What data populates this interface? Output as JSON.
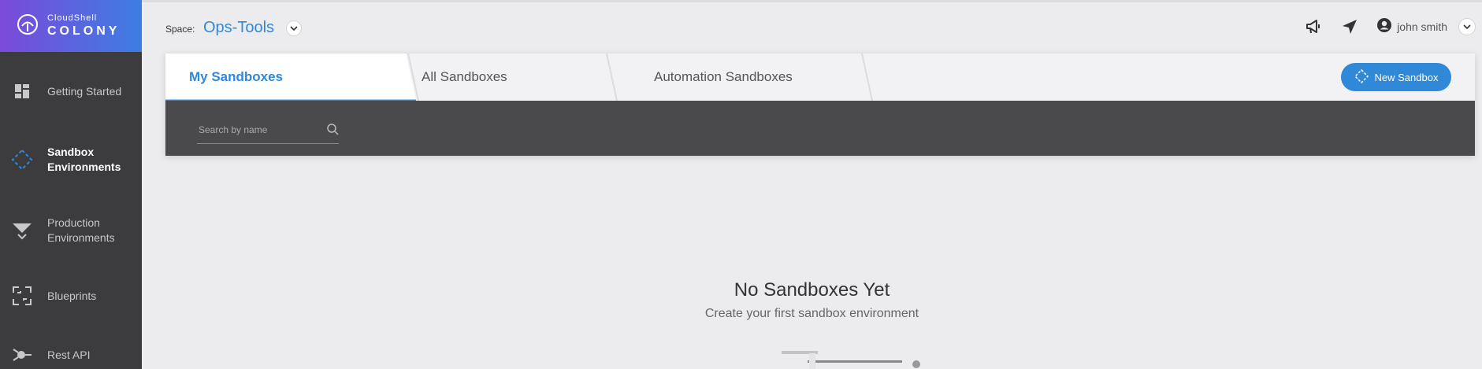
{
  "brand": {
    "small": "CloudShell",
    "big": "COLONY"
  },
  "sidebar": {
    "items": [
      {
        "label": "Getting Started",
        "icon": "dashboard-icon"
      },
      {
        "label": "Sandbox Environments",
        "icon": "sandbox-diamond-icon",
        "active": true
      },
      {
        "label": "Production Environments",
        "icon": "funnel-icon"
      },
      {
        "label": "Blueprints",
        "icon": "blueprint-icon"
      },
      {
        "label": "Rest API",
        "icon": "api-icon"
      }
    ]
  },
  "header": {
    "space_label": "Space:",
    "space_value": "Ops-Tools",
    "user_name": "john smith"
  },
  "tabs": [
    {
      "label": "My Sandboxes",
      "active": true
    },
    {
      "label": "All Sandboxes"
    },
    {
      "label": "Automation Sandboxes"
    }
  ],
  "toolbar": {
    "new_sandbox_label": "New Sandbox"
  },
  "search": {
    "placeholder": "Search by name"
  },
  "empty_state": {
    "title": "No Sandboxes Yet",
    "subtitle": "Create your first sandbox environment"
  },
  "colors": {
    "accent": "#2f88d8",
    "sidebar": "#3c3c3e",
    "logo_gradient_start": "#7b4ad9",
    "logo_gradient_end": "#3d7de3"
  }
}
